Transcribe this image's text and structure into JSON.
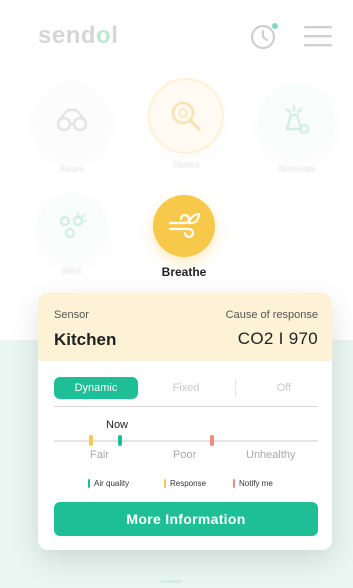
{
  "header": {
    "logo_main": "send",
    "logo_accent": "o",
    "logo_tail": "l",
    "history_icon": "history-clock-icon",
    "menu_icon": "hamburger-menu-icon"
  },
  "modes": [
    {
      "label": "Aware",
      "icon": "glasses-icon",
      "state": "faded"
    },
    {
      "label": "Detect",
      "icon": "magnify-sensor-icon",
      "state": "faded"
    },
    {
      "label": "Illuminate",
      "icon": "lamp-icon",
      "state": "faded"
    },
    {
      "label": "Blink",
      "icon": "blink-icon",
      "state": "faded"
    },
    {
      "label": "Breathe",
      "icon": "wind-leaf-icon",
      "state": "active"
    }
  ],
  "card": {
    "sensor_label": "Sensor",
    "sensor_value": "Kitchen",
    "cause_label": "Cause of response",
    "cause_value": "CO2 I 970",
    "tabs": [
      {
        "label": "Dynamic",
        "active": true
      },
      {
        "label": "Fixed",
        "active": false
      },
      {
        "label": "Off",
        "active": false
      }
    ],
    "now_label": "Now",
    "scale": [
      "Fair",
      "Poor",
      "Unhealthy"
    ],
    "markers": {
      "response_position_pct": 14,
      "air_quality_position_pct": 25,
      "notify_position_pct": 60
    },
    "legend": [
      {
        "label": "Air quality",
        "color": "#1ebf96"
      },
      {
        "label": "Response",
        "color": "#f7c84a"
      },
      {
        "label": "Notify me",
        "color": "#f08a7a"
      }
    ],
    "more_button": "More Information"
  },
  "colors": {
    "accent": "#1ebf96",
    "yellow": "#f7c84a",
    "notify": "#f08a7a",
    "card_header": "#fdf1d6"
  }
}
